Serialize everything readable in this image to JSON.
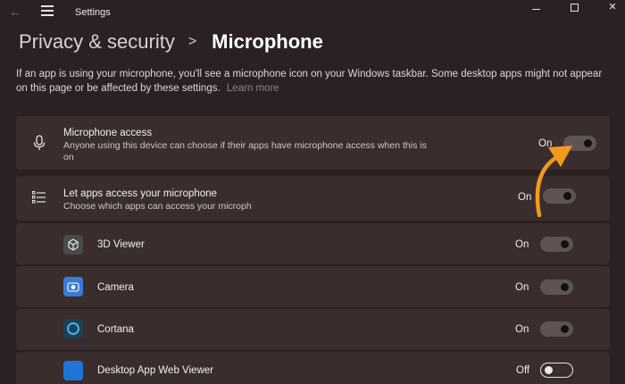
{
  "window": {
    "title": "Settings"
  },
  "breadcrumb": {
    "parent": "Privacy & security",
    "separator": ">",
    "current": "Microphone"
  },
  "description": {
    "text": "If an app is using your microphone, you'll see a microphone icon on your Windows taskbar. Some desktop apps might not appear on this page or be affected by these settings.",
    "link": "Learn more"
  },
  "settings": {
    "mic_access": {
      "title": "Microphone access",
      "subtitle_line1": "Anyone using this device can choose if their apps have microphone access when this is",
      "subtitle_line2": "on",
      "state": "On",
      "icon": "microphone-icon"
    },
    "apps_access": {
      "title": "Let apps access your microphone",
      "subtitle": "Choose which apps can access your microph",
      "state": "On",
      "icon": "list-icon"
    }
  },
  "apps": [
    {
      "name": "3D Viewer",
      "state": "On",
      "icon": "3d-viewer-icon",
      "color": "#4a4a4a"
    },
    {
      "name": "Camera",
      "state": "On",
      "icon": "camera-icon",
      "color": "#3a7bd5"
    },
    {
      "name": "Cortana",
      "state": "On",
      "icon": "cortana-icon",
      "color": "#1f3f55"
    },
    {
      "name": "Desktop App Web Viewer",
      "state": "Off",
      "icon": "desktop-app-web-viewer-icon",
      "color": "#1f74d6"
    }
  ],
  "colors": {
    "background": "#2c2122",
    "card": "#3a2d2e",
    "arrow": "#f39a1d"
  }
}
